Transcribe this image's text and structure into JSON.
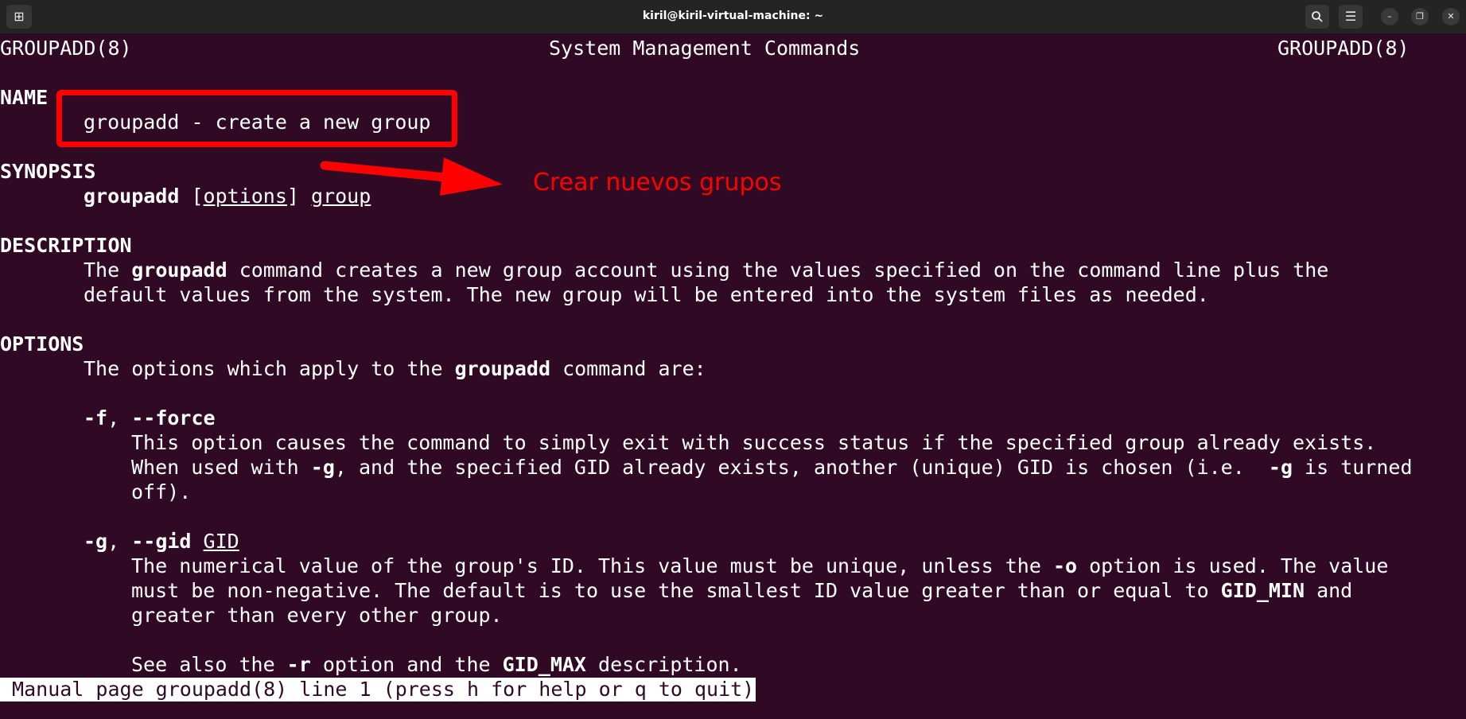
{
  "window": {
    "title": "kiril@kiril-virtual-machine: ~",
    "icons": {
      "new_tab": "new-tab-icon",
      "search": "search-icon",
      "menu": "hamburger-menu-icon",
      "minimize": "minimize-icon",
      "restore": "restore-icon",
      "close": "close-icon"
    }
  },
  "man": {
    "header_left": "GROUPADD(8)",
    "header_center": "System Management Commands",
    "header_right": "GROUPADD(8)",
    "name_heading": "NAME",
    "name_line": "groupadd - create a new group",
    "synopsis_heading": "SYNOPSIS",
    "synopsis": {
      "cmd": "groupadd",
      "open": "[",
      "options": "options",
      "close": "]",
      "group": "group"
    },
    "description_heading": "DESCRIPTION",
    "desc1": {
      "pre": "The ",
      "cmd": "groupadd",
      "post": " command creates a new group account using the values specified on the command line plus the"
    },
    "desc2": "default values from the system. The new group will be entered into the system files as needed.",
    "options_heading": "OPTIONS",
    "opts_intro": {
      "pre": "The options which apply to the ",
      "cmd": "groupadd",
      "post": " command are:"
    },
    "force_opt": {
      "short": "-f",
      "sep": ", ",
      "long": "--force"
    },
    "force1": "This option causes the command to simply exit with success status if the specified group already exists.",
    "force2": {
      "pre": "When used with ",
      "g1": "-g",
      "mid": ", and the specified GID already exists, another (unique) GID is chosen (i.e.  ",
      "g2": "-g",
      "post": " is turned"
    },
    "force3": "off).",
    "gid_opt": {
      "short": "-g",
      "sep": ", ",
      "long": "--gid",
      "space": " ",
      "arg": "GID"
    },
    "gid1": {
      "pre": "The numerical value of the group's ID. This value must be unique, unless the ",
      "o": "-o",
      "post": " option is used. The value"
    },
    "gid2": {
      "pre": "must be non-negative. The default is to use the smallest ID value greater than or equal to ",
      "min": "GID_MIN",
      "post": " and"
    },
    "gid3": "greater than every other group.",
    "see": {
      "pre": "See also the ",
      "r": "-r",
      "mid": " option and the ",
      "max": "GID_MAX",
      "post": " description."
    }
  },
  "status_bar": " Manual page groupadd(8) line 1 (press h for help or q to quit)",
  "annotation": {
    "text": "Crear nuevos grupos",
    "color": "#ff0000"
  }
}
